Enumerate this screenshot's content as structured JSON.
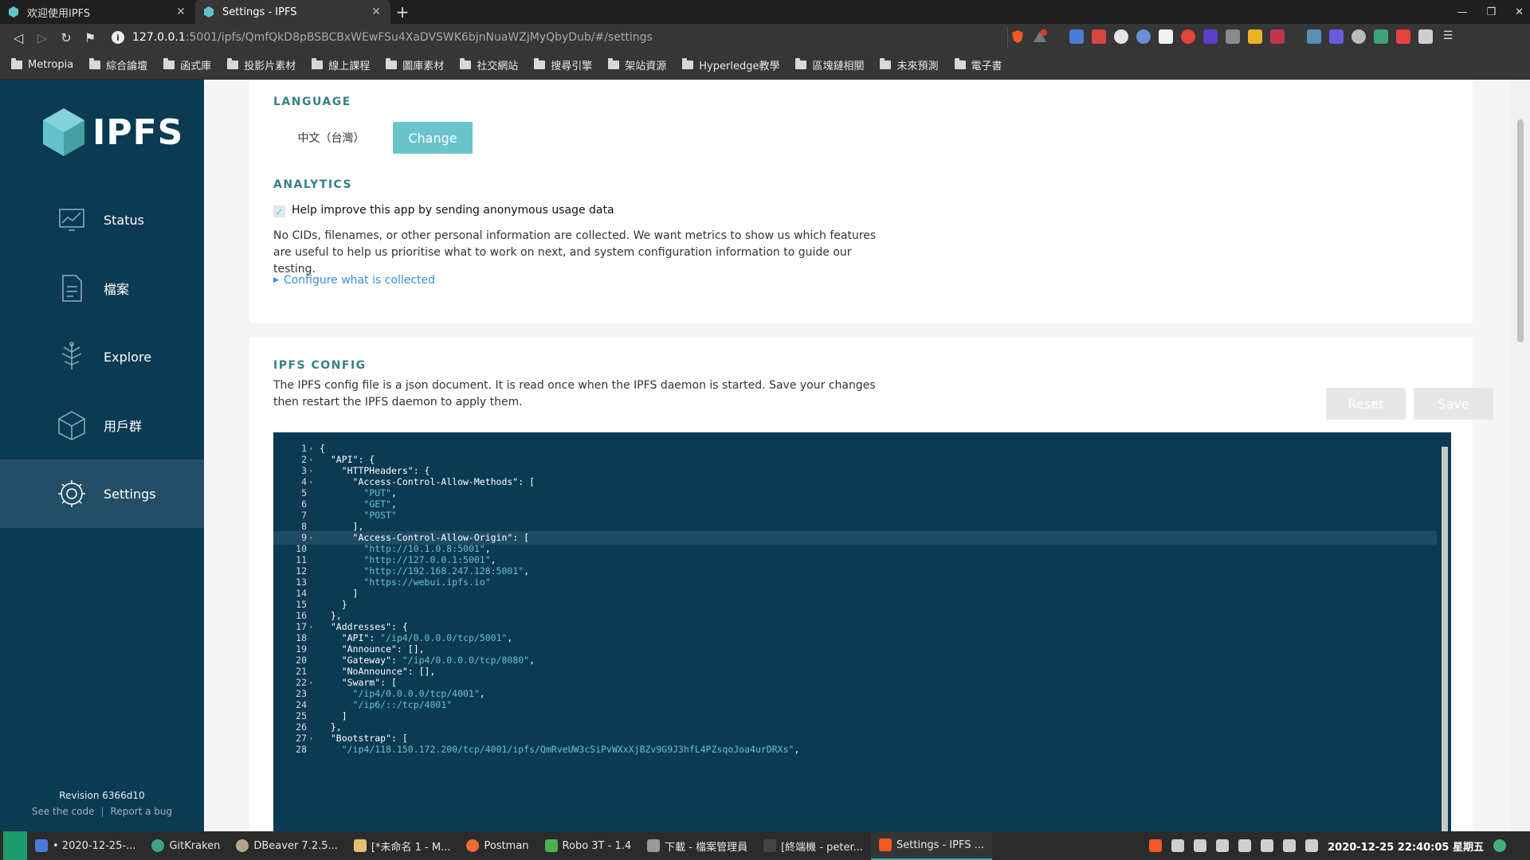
{
  "browser": {
    "tabs": [
      {
        "title": "欢迎使用IPFS",
        "active": false
      },
      {
        "title": "Settings - IPFS",
        "active": true
      }
    ],
    "url_host": "127.0.0.1",
    "url_rest": ":5001/ipfs/QmfQkD8pBSBCBxWEwFSu4XaDVSWK6bjnNuaWZjMyQbyDub/#/settings",
    "bookmarks": [
      "Metropia",
      "綜合論壇",
      "函式庫",
      "投影片素材",
      "線上課程",
      "圖庫素材",
      "社交網站",
      "搜尋引擎",
      "架站資源",
      "Hyperledge教學",
      "區塊鏈相關",
      "未來預測",
      "電子書"
    ]
  },
  "sidebar": {
    "logo": "IPFS",
    "items": [
      {
        "label": "Status",
        "icon": "status-icon"
      },
      {
        "label": "檔案",
        "icon": "files-icon"
      },
      {
        "label": "Explore",
        "icon": "explore-icon"
      },
      {
        "label": "用戶群",
        "icon": "peers-icon"
      },
      {
        "label": "Settings",
        "icon": "gear-icon"
      }
    ],
    "revision": "Revision 6366d10",
    "see_code": "See the code",
    "report_bug": "Report a bug"
  },
  "language": {
    "title": "LANGUAGE",
    "current": "中文（台灣）",
    "change_label": "Change"
  },
  "analytics": {
    "title": "ANALYTICS",
    "checkbox_label": "Help improve this app by sending anonymous usage data",
    "checked": true,
    "description": "No CIDs, filenames, or other personal information are collected. We want metrics to show us which features are useful to help us prioritise what to work on next, and system configuration information to guide our testing.",
    "configure_link": "Configure what is collected"
  },
  "config": {
    "title": "IPFS CONFIG",
    "description": "The IPFS config file is a json document. It is read once when the IPFS daemon is started. Save your changes then restart the IPFS daemon to apply them.",
    "reset_label": "Reset",
    "save_label": "Save",
    "lines": [
      {
        "n": "1",
        "key": "{",
        "val": "",
        "tail": "",
        "fold": true
      },
      {
        "n": "2",
        "key": "  \"API\": {",
        "val": "",
        "tail": "",
        "fold": true
      },
      {
        "n": "3",
        "key": "    \"HTTPHeaders\": {",
        "val": "",
        "tail": "",
        "fold": true
      },
      {
        "n": "4",
        "key": "      \"Access-Control-Allow-Methods\": [",
        "val": "",
        "tail": "",
        "fold": true
      },
      {
        "n": "5",
        "key": "        ",
        "val": "\"PUT\"",
        "tail": ",",
        "fold": false
      },
      {
        "n": "6",
        "key": "        ",
        "val": "\"GET\"",
        "tail": ",",
        "fold": false
      },
      {
        "n": "7",
        "key": "        ",
        "val": "\"POST\"",
        "tail": "",
        "fold": false
      },
      {
        "n": "8",
        "key": "      ],",
        "val": "",
        "tail": "",
        "fold": false
      },
      {
        "n": "9",
        "key": "      \"Access-Control-Allow-Origin\": [",
        "val": "",
        "tail": "",
        "fold": true
      },
      {
        "n": "10",
        "key": "        ",
        "val": "\"http://10.1.0.8:5001\"",
        "tail": ",",
        "fold": false
      },
      {
        "n": "11",
        "key": "        ",
        "val": "\"http://127.0.0.1:5001\"",
        "tail": ",",
        "fold": false
      },
      {
        "n": "12",
        "key": "        ",
        "val": "\"http://192.168.247.128:5001\"",
        "tail": ",",
        "fold": false
      },
      {
        "n": "13",
        "key": "        ",
        "val": "\"https://webui.ipfs.io\"",
        "tail": "",
        "fold": false
      },
      {
        "n": "14",
        "key": "      ]",
        "val": "",
        "tail": "",
        "fold": false
      },
      {
        "n": "15",
        "key": "    }",
        "val": "",
        "tail": "",
        "fold": false
      },
      {
        "n": "16",
        "key": "  },",
        "val": "",
        "tail": "",
        "fold": false
      },
      {
        "n": "17",
        "key": "  \"Addresses\": {",
        "val": "",
        "tail": "",
        "fold": true
      },
      {
        "n": "18",
        "key": "    \"API\": ",
        "val": "\"/ip4/0.0.0.0/tcp/5001\"",
        "tail": ",",
        "fold": false
      },
      {
        "n": "19",
        "key": "    \"Announce\": [],",
        "val": "",
        "tail": "",
        "fold": false
      },
      {
        "n": "20",
        "key": "    \"Gateway\": ",
        "val": "\"/ip4/0.0.0.0/tcp/8080\"",
        "tail": ",",
        "fold": false
      },
      {
        "n": "21",
        "key": "    \"NoAnnounce\": [],",
        "val": "",
        "tail": "",
        "fold": false
      },
      {
        "n": "22",
        "key": "    \"Swarm\": [",
        "val": "",
        "tail": "",
        "fold": true
      },
      {
        "n": "23",
        "key": "      ",
        "val": "\"/ip4/0.0.0.0/tcp/4001\"",
        "tail": ",",
        "fold": false
      },
      {
        "n": "24",
        "key": "      ",
        "val": "\"/ip6/::/tcp/4001\"",
        "tail": "",
        "fold": false
      },
      {
        "n": "25",
        "key": "    ]",
        "val": "",
        "tail": "",
        "fold": false
      },
      {
        "n": "26",
        "key": "  },",
        "val": "",
        "tail": "",
        "fold": false
      },
      {
        "n": "27",
        "key": "  \"Bootstrap\": [",
        "val": "",
        "tail": "",
        "fold": true
      },
      {
        "n": "28",
        "key": "    ",
        "val": "\"/ip4/118.150.172.200/tcp/4001/ipfs/QmRveUW3cSiPvWXxXjBZv9G9J3hfL4PZsqoJoa4urDRXs\"",
        "tail": ",",
        "fold": false
      }
    ],
    "highlight_line": "9"
  },
  "taskbar": {
    "items": [
      {
        "label": "• 2020-12-25-...",
        "active": false
      },
      {
        "label": "GitKraken",
        "active": false
      },
      {
        "label": "DBeaver 7.2.5...",
        "active": false
      },
      {
        "label": "[*未命名 1 - M...",
        "active": false
      },
      {
        "label": "Postman",
        "active": false
      },
      {
        "label": "Robo 3T - 1.4",
        "active": false
      },
      {
        "label": "下載 - 檔案管理員",
        "active": false
      },
      {
        "label": "[終端機 - peter...",
        "active": false
      },
      {
        "label": "Settings - IPFS ...",
        "active": true
      }
    ],
    "clock": "2020-12-25 22:40:05 星期五"
  },
  "colors": {
    "sidebar_bg": "#0b3a53",
    "accent_teal": "#69c4cd",
    "section_title": "#378085",
    "link_blue": "#378ed9"
  }
}
